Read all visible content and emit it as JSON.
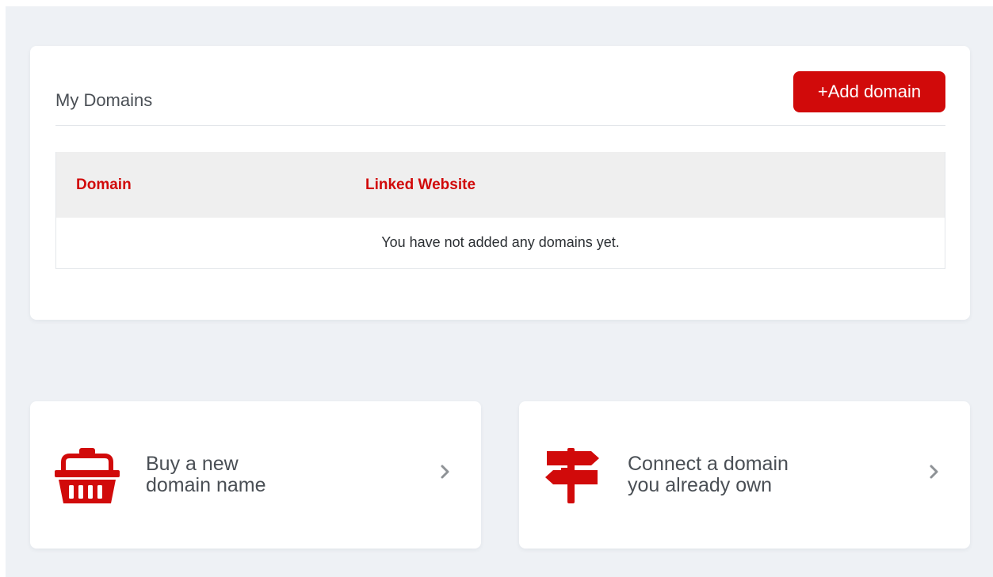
{
  "domains": {
    "title": "My Domains",
    "add_button": "+Add domain",
    "columns": [
      "Domain",
      "Linked Website"
    ],
    "empty_message": "You have not added any domains yet."
  },
  "actions": [
    {
      "icon": "basket-icon",
      "line1": "Buy a new",
      "line2": "domain name"
    },
    {
      "icon": "signpost-icon",
      "line1": "Connect a domain",
      "line2": "you already own"
    }
  ],
  "colors": {
    "accent": "#d10a0a",
    "background": "#eef1f5",
    "card": "#ffffff",
    "header_row": "#efefef",
    "text": "#4a4f55",
    "chevron": "#8e9296"
  }
}
